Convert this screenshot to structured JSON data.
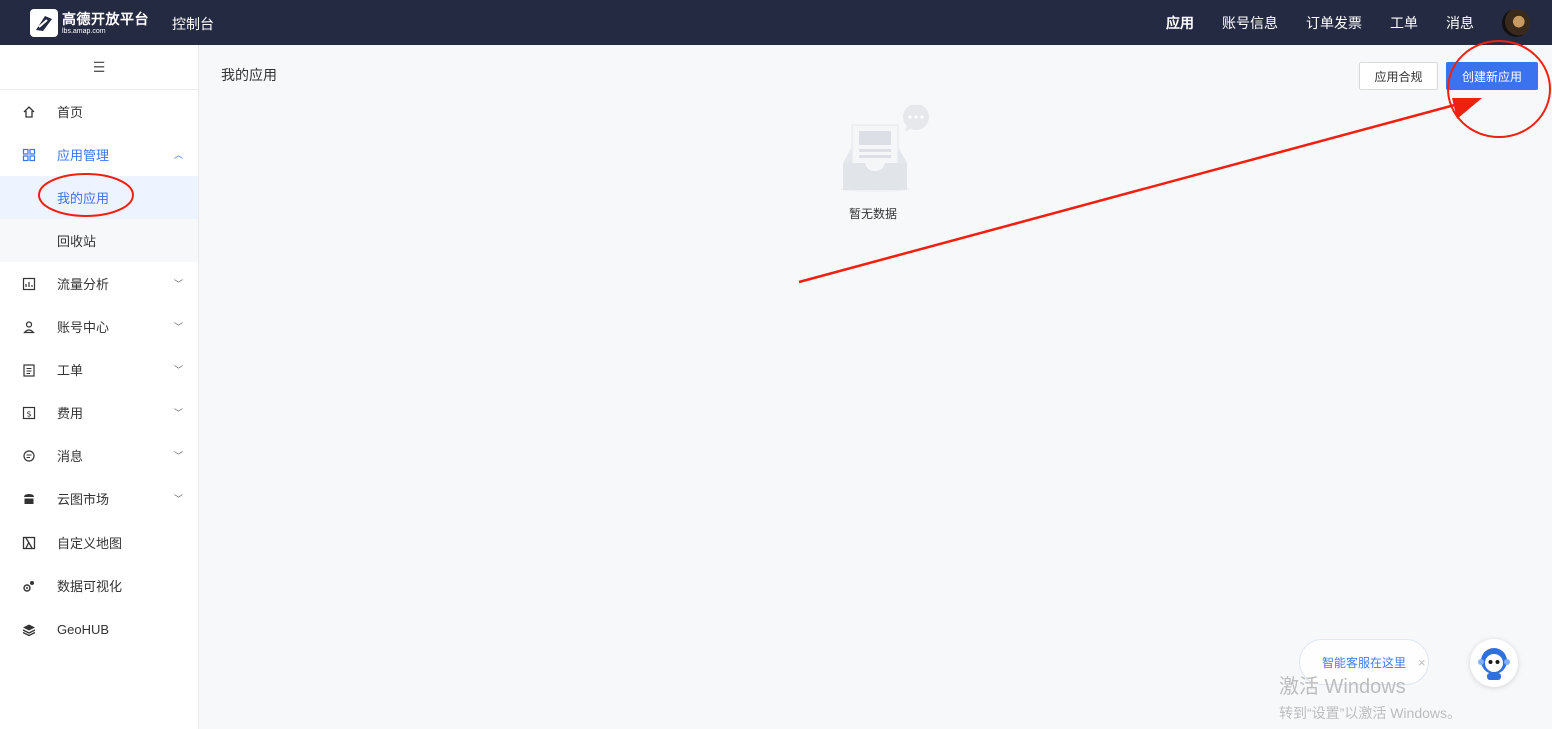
{
  "topbar": {
    "logo_title": "高德开放平台",
    "logo_sub": "lbs.amap.com",
    "console": "控制台",
    "nav": [
      "应用",
      "账号信息",
      "订单发票",
      "工单",
      "消息"
    ]
  },
  "sidebar": {
    "items": [
      {
        "label": "首页",
        "icon": "home-icon"
      },
      {
        "label": "应用管理",
        "icon": "grid-icon",
        "expanded": true
      },
      {
        "label": "我的应用",
        "sub": true,
        "active": true
      },
      {
        "label": "回收站",
        "sub": true
      },
      {
        "label": "流量分析",
        "icon": "chart-icon"
      },
      {
        "label": "账号中心",
        "icon": "user-icon"
      },
      {
        "label": "工单",
        "icon": "clipboard-icon"
      },
      {
        "label": "费用",
        "icon": "money-icon"
      },
      {
        "label": "消息",
        "icon": "message-icon"
      },
      {
        "label": "云图市场",
        "icon": "store-icon"
      },
      {
        "label": "自定义地图",
        "icon": "map-icon"
      },
      {
        "label": "数据可视化",
        "icon": "visual-icon"
      },
      {
        "label": "GeoHUB",
        "icon": "layers-icon"
      }
    ]
  },
  "main": {
    "title": "我的应用",
    "btn_compliance": "应用合规",
    "btn_create": "创建新应用",
    "empty_text": "暂无数据"
  },
  "service": {
    "label": "智能客服在这里",
    "close": "×"
  },
  "watermark": {
    "line1": "激活 Windows",
    "line2": "转到“设置”以激活 Windows。"
  },
  "colors": {
    "topbar": "#252a43",
    "accent": "#3b73ee",
    "annotation": "#f02010"
  }
}
